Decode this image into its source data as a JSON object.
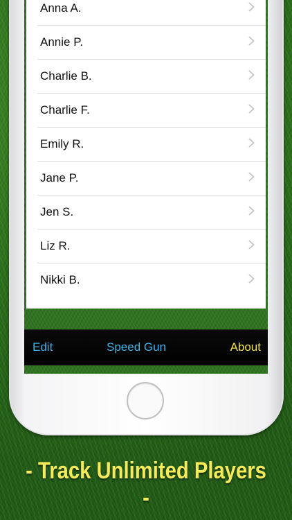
{
  "players": [
    {
      "name": "Anna A."
    },
    {
      "name": "Annie P."
    },
    {
      "name": "Charlie B."
    },
    {
      "name": "Charlie F."
    },
    {
      "name": "Emily R."
    },
    {
      "name": "Jane P."
    },
    {
      "name": "Jen S."
    },
    {
      "name": "Liz R."
    },
    {
      "name": "Nikki B."
    }
  ],
  "toolbar": {
    "edit_label": "Edit",
    "speed_gun_label": "Speed Gun",
    "about_label": "About"
  },
  "tagline": "- Track Unlimited Players -",
  "icons": {
    "row_disclosure": "chevron-right-icon",
    "home": "home-button"
  },
  "colors": {
    "toolbar_link": "#3ab3e8",
    "toolbar_about": "#f4e04a",
    "tagline": "#f4ea5a"
  }
}
